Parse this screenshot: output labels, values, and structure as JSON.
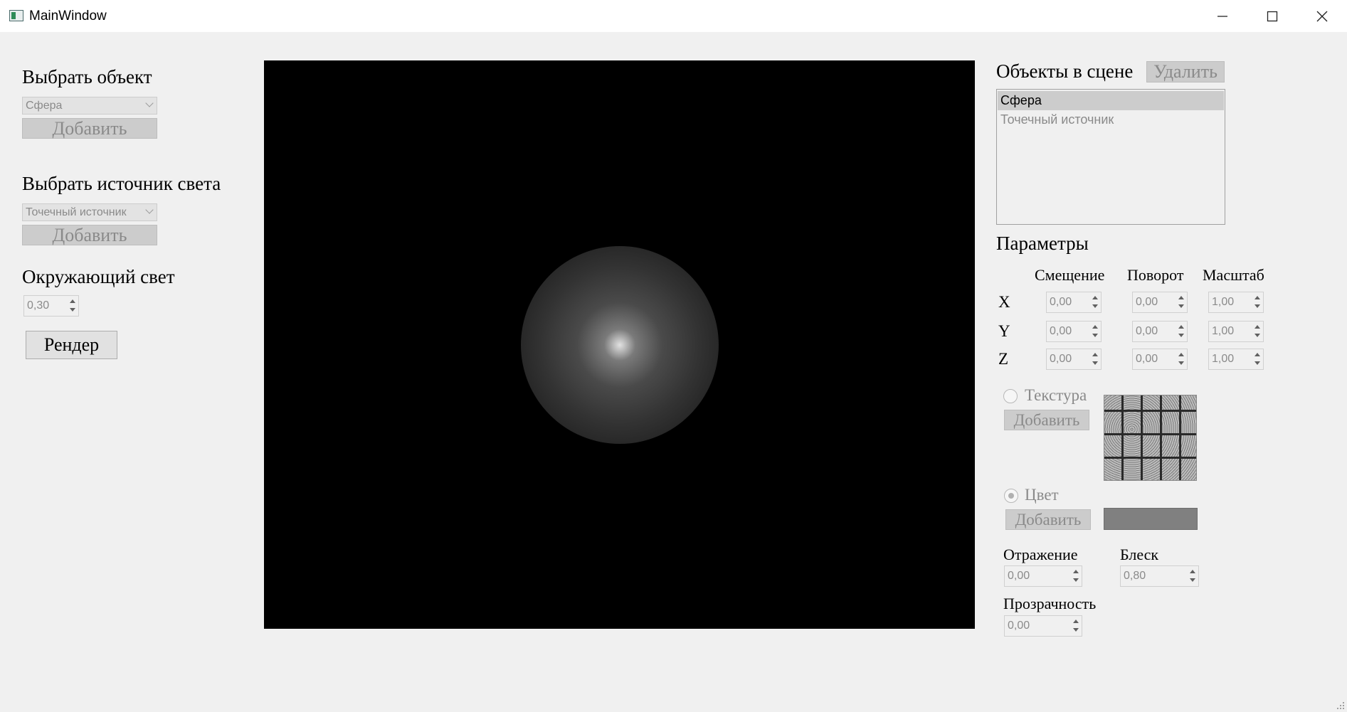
{
  "window": {
    "title": "MainWindow",
    "icon": "app-window-icon"
  },
  "left_panel": {
    "object_heading": "Выбрать объект",
    "object_select_value": "Сфера",
    "object_add_label": "Добавить",
    "light_heading": "Выбрать источник света",
    "light_select_value": "Точечный источник",
    "light_add_label": "Добавить",
    "ambient_heading": "Окружающий свет",
    "ambient_value": "0,30",
    "render_label": "Рендер"
  },
  "scene": {
    "heading": "Объекты в сцене",
    "delete_label": "Удалить",
    "items": [
      "Сфера",
      "Точечный источник"
    ],
    "selected_index": 0
  },
  "params": {
    "heading": "Параметры",
    "columns": [
      "Смещение",
      "Поворот",
      "Масштаб"
    ],
    "rows": [
      {
        "axis": "X",
        "offset": "0,00",
        "rotation": "0,00",
        "scale": "1,00"
      },
      {
        "axis": "Y",
        "offset": "0,00",
        "rotation": "0,00",
        "scale": "1,00"
      },
      {
        "axis": "Z",
        "offset": "0,00",
        "rotation": "0,00",
        "scale": "1,00"
      }
    ],
    "texture_label": "Текстура",
    "texture_add_label": "Добавить",
    "color_label": "Цвет",
    "color_add_label": "Добавить",
    "color_value": "#808080",
    "reflection_label": "Отражение",
    "reflection_value": "0,00",
    "shine_label": "Блеск",
    "shine_value": "0,80",
    "transparency_label": "Прозрачность",
    "transparency_value": "0,00"
  }
}
